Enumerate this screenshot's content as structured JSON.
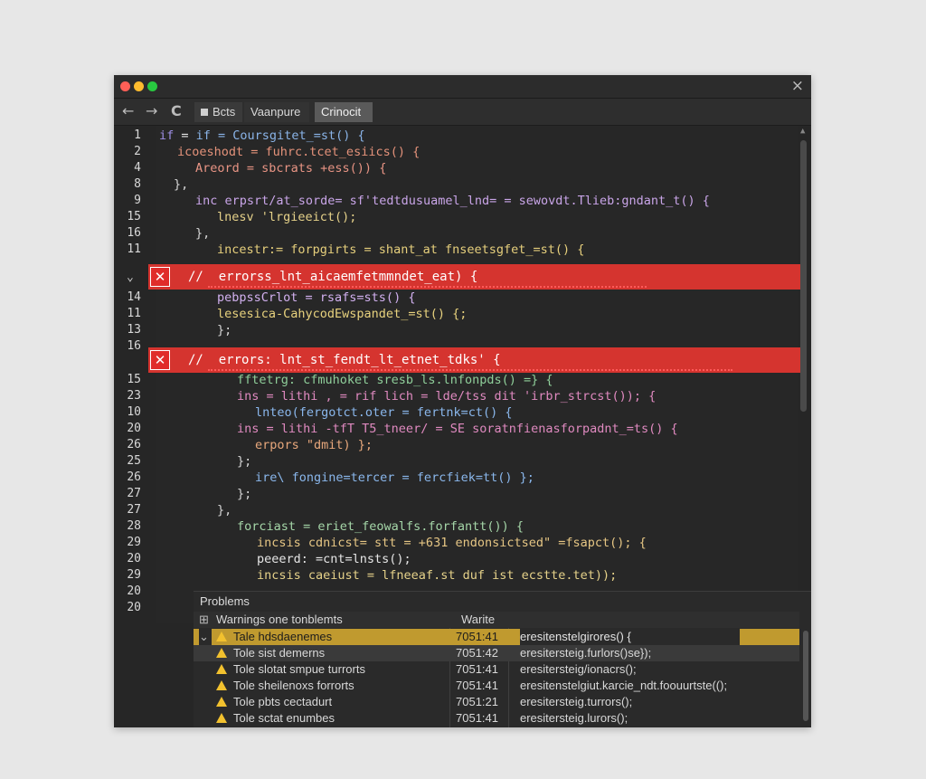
{
  "colors": {
    "error_band": "#d5342f",
    "warning_icon": "#f2c12e",
    "selected_row": "#c09a2f",
    "hover_row": "#3a3a3a",
    "keyword": "#e0e0e0"
  },
  "window": {
    "close_icon": "×",
    "dots": [
      "#ff5f57",
      "#febc2e",
      "#28c840"
    ]
  },
  "toolbar": {
    "back_icon": "←",
    "forward_icon": "→",
    "refresh_icon": "C",
    "tabs": [
      "Bcts",
      "Vaanpure",
      "Crinocit"
    ]
  },
  "gutter": {
    "lines": [
      "1",
      "2",
      "4",
      "8",
      "9",
      "15",
      "16",
      "11",
      "",
      "14",
      "11",
      "13",
      "16",
      "",
      "15",
      "23",
      "10",
      "20",
      "26",
      "25",
      "26",
      "27",
      "27",
      "28",
      "29",
      "20",
      "29",
      "20",
      "20"
    ],
    "fold_arrow": "⌄"
  },
  "code": [
    {
      "indent": "",
      "text": "if = Coursgitet_=st() {"
    },
    {
      "indent": "  ",
      "text": "icoeshodt = fuhrc.tcet_esiics() {"
    },
    {
      "indent": "    ",
      "text": "Areord = sbcrats +ess()) {"
    },
    {
      "indent": "  ",
      "text": "},"
    },
    {
      "indent": "    ",
      "text": "inc erpsrt/at_sorde= sf'tedtdusuamel_lnd= = sewovdt.Tlieb:gndant_t() {"
    },
    {
      "indent": "      ",
      "text": "lnesv 'lrgieeict();"
    },
    {
      "indent": "    ",
      "text": "},"
    },
    {
      "indent": "      ",
      "text": "incestr:= forpgirts = shant_at fnseetsgfet_=st() {"
    },
    {
      "indent": "      ",
      "text": "pebpssCrlot = rsafs=sts() {"
    },
    {
      "indent": "      ",
      "text": "lesesica-CahycodEwspandet_=st() {;"
    },
    {
      "indent": "      ",
      "text": "};"
    },
    {
      "indent": "        ",
      "text": "fftetrg: cfmuhoket sresb_ls.lnfonpds() =} {"
    },
    {
      "indent": "        ",
      "text": "ins = lithi , = rif lich = lde/tss dit 'irbr_strcst()); {"
    },
    {
      "indent": "          ",
      "text": "lnteo(fergotct.oter = fertnk=ct() {"
    },
    {
      "indent": "        ",
      "text": "ins = lithi -tfT T5_tneer/ = SE soratnfienasforpadnt_=ts() {"
    },
    {
      "indent": "          ",
      "text": "erpors \"dmit) };"
    },
    {
      "indent": "        ",
      "text": "};"
    },
    {
      "indent": "          ",
      "text": "ire\\ fongine=tercer = fercfiek=tt() };"
    },
    {
      "indent": "        ",
      "text": "};"
    },
    {
      "indent": "      ",
      "text": "},"
    },
    {
      "indent": "        ",
      "text": "forciast = eriet_feowalfs.forfantt()) {"
    },
    {
      "indent": "          ",
      "text": "incsis cdnicst= stt = +631 endonsictsed\" =fsapct(); {"
    },
    {
      "indent": "          ",
      "text": "peeerd: =cnt=lnsts();"
    },
    {
      "indent": "          ",
      "text": "incsis caeiust = lfneeaf.st duf ist ecstte.tet));"
    }
  ],
  "errors": [
    {
      "prefix": "//",
      "message": "errorss_lnt_aicaemfetmmndet_eat) {"
    },
    {
      "prefix": "//",
      "message": "errors: lnt_st_fendt_lt_etnet_tdks' {"
    }
  ],
  "problems": {
    "title": "Problems",
    "header": {
      "label": "Warnings one tonblemts",
      "col2": "Warite"
    },
    "rows": [
      {
        "label": "Tale hdsdaenemes",
        "code": "7051:41",
        "detail": "eresitenstelgirores() {"
      },
      {
        "label": "Tole sist demerns",
        "code": "7051:42",
        "detail": "eresitersteig.furlors()se});"
      },
      {
        "label": "Tole slotat smpue turrorts",
        "code": "7051:41",
        "detail": "eresitersteig/ionacrs();"
      },
      {
        "label": "Tole sheilenoxs forrorts",
        "code": "7051:41",
        "detail": "eresitenstelgiut.karcie_ndt.foouurtste(();"
      },
      {
        "label": "Tole pbts cectadurt",
        "code": "7051:21",
        "detail": "eresitersteig.turrors();"
      },
      {
        "label": "Tole sctat enumbes",
        "code": "7051:41",
        "detail": "eresitersteig.lurors();"
      }
    ]
  }
}
